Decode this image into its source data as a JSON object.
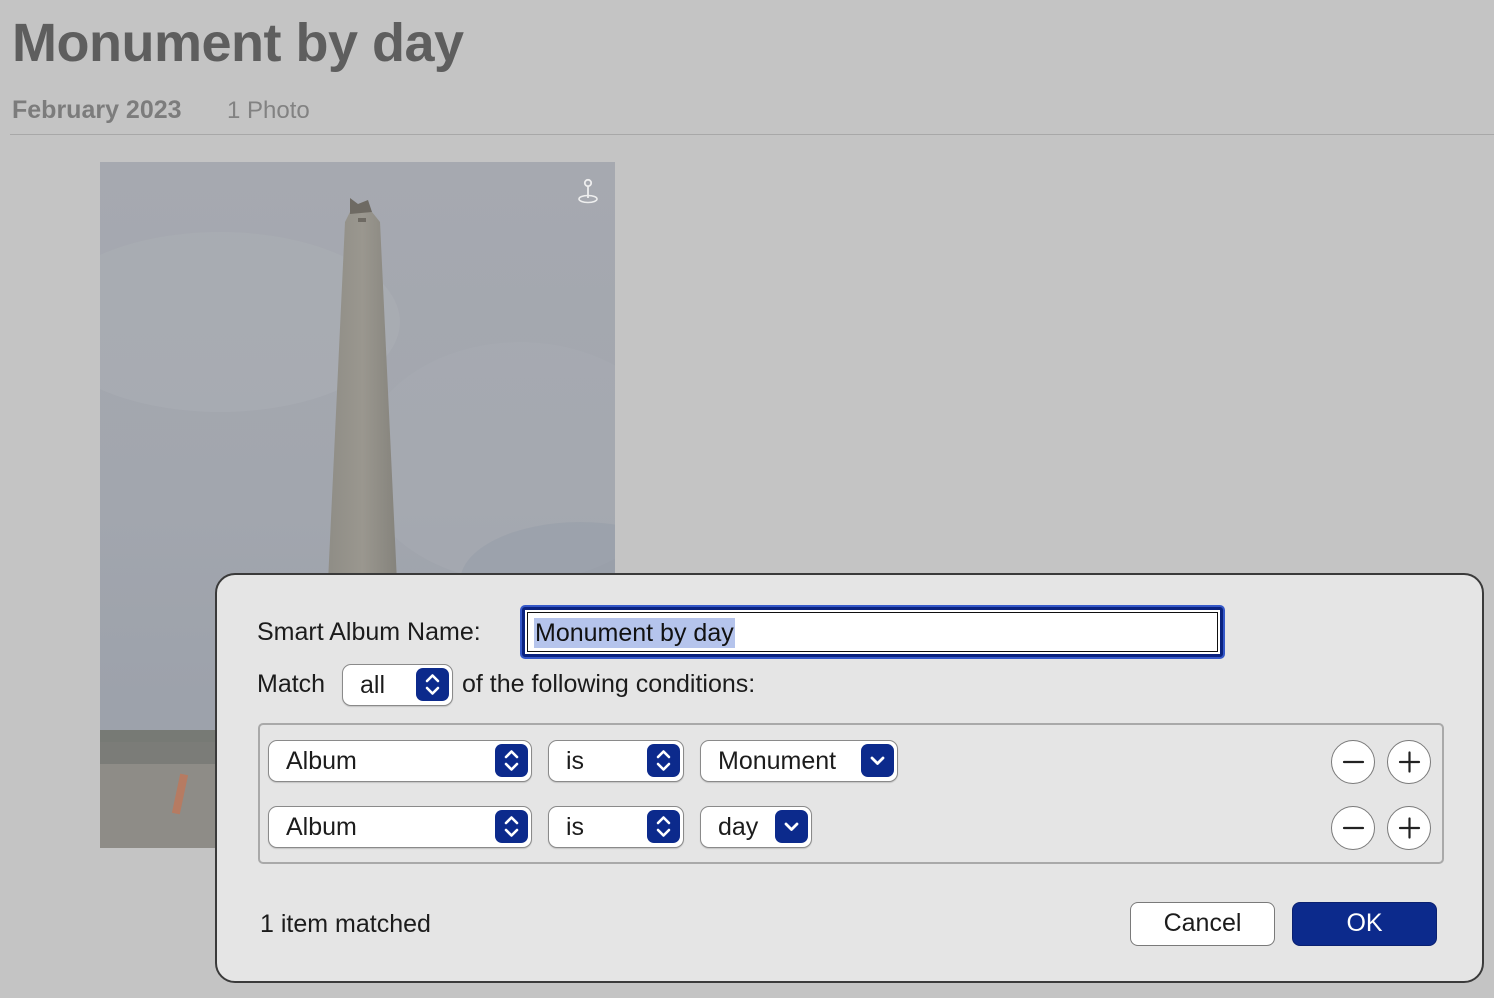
{
  "header": {
    "title": "Monument by day",
    "date": "February 2023",
    "count": "1 Photo"
  },
  "photo": {
    "subject": "monument obelisk under cloudy sky"
  },
  "dialog": {
    "name_label": "Smart Album Name:",
    "name_value": "Monument by day",
    "match_label": "Match",
    "match_value": "all",
    "conditions_label": "of the following conditions:",
    "rules": [
      {
        "field": "Album",
        "operator": "is",
        "value": "Monument"
      },
      {
        "field": "Album",
        "operator": "is",
        "value": "day"
      }
    ],
    "status": "1 item matched",
    "cancel_label": "Cancel",
    "ok_label": "OK"
  },
  "colors": {
    "accent": "#0c2a8c",
    "dialog_bg": "#e5e5e5",
    "selection": "#b5c4ec"
  }
}
